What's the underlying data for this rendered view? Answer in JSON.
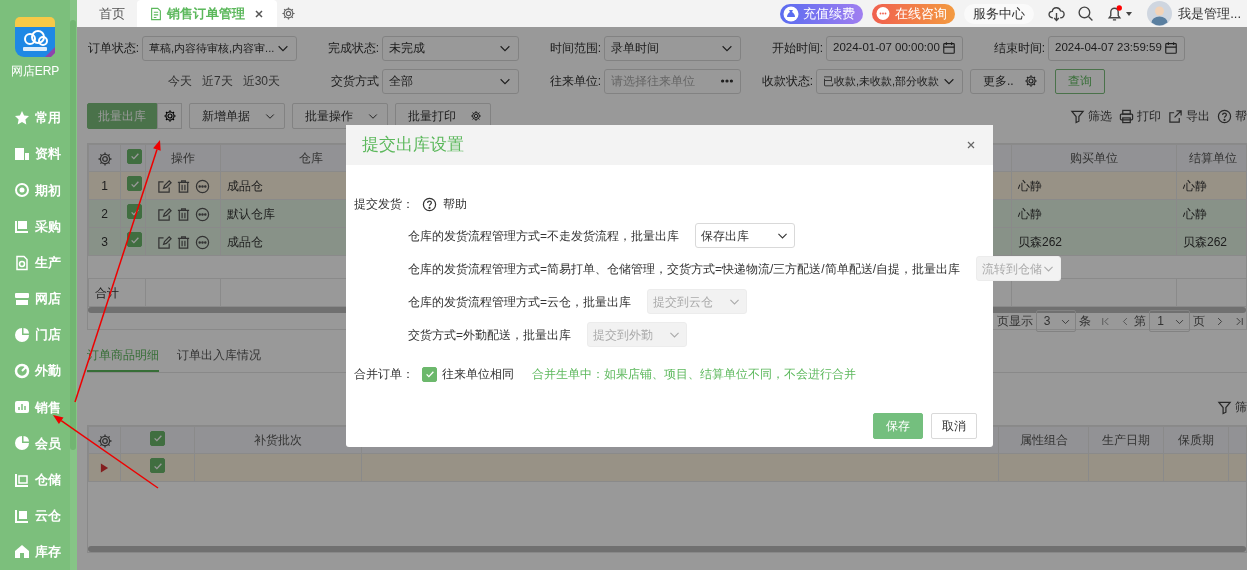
{
  "top_tabs": [
    {
      "label": "首页",
      "selected": false
    },
    {
      "label": "销售订单管理",
      "selected": true
    }
  ],
  "header": {
    "recharge": "充值续费",
    "consult": "在线咨询",
    "service": "服务中心",
    "user": "我是管理...",
    "unread": true
  },
  "sidebar": {
    "app_name": "网店ERP",
    "items": [
      {
        "label": "常用"
      },
      {
        "label": "资料"
      },
      {
        "label": "期初"
      },
      {
        "label": "采购"
      },
      {
        "label": "生产"
      },
      {
        "label": "网店"
      },
      {
        "label": "门店"
      },
      {
        "label": "外勤"
      },
      {
        "label": "销售"
      },
      {
        "label": "会员"
      },
      {
        "label": "仓储"
      },
      {
        "label": "云仓"
      },
      {
        "label": "库存"
      }
    ]
  },
  "filters": [
    [
      {
        "kind": "select",
        "label": "订单状态:",
        "value": "草稿,内容待审核,内容审..."
      },
      {
        "kind": "select",
        "label": "完成状态:",
        "value": "未完成"
      },
      {
        "kind": "select",
        "label": "时间范围:",
        "value": "录单时间"
      },
      {
        "kind": "date",
        "label": "开始时间:",
        "value": "2024-01-07 00:00:00"
      },
      {
        "kind": "date",
        "label": "结束时间:",
        "value": "2024-04-07 23:59:59"
      }
    ],
    [
      {
        "kind": "quick_dates",
        "options": [
          "今天",
          "近7天",
          "近30天"
        ]
      },
      {
        "kind": "select",
        "label": "交货方式",
        "value": "全部"
      },
      {
        "kind": "lookup",
        "label": "往来单位:",
        "placeholder": "请选择往来单位"
      },
      {
        "kind": "select",
        "label": "收款状态:",
        "value": "已收款,未收款,部分收款"
      },
      {
        "kind": "more",
        "label": "更多.."
      },
      {
        "kind": "search",
        "label": "查询"
      }
    ]
  ],
  "toolbar": {
    "buttons": [
      {
        "kind": "split-primary",
        "label": "批量出库"
      },
      {
        "kind": "dropdown",
        "label": "新增单据"
      },
      {
        "kind": "dropdown",
        "label": "批量操作"
      },
      {
        "kind": "split",
        "label": "批量打印"
      }
    ],
    "actions": [
      {
        "kind": "filter",
        "label": "筛选"
      },
      {
        "kind": "print",
        "label": "打印"
      },
      {
        "kind": "export",
        "label": "导出"
      },
      {
        "kind": "help",
        "label": "帮"
      }
    ]
  },
  "orders_table": {
    "header_checked": true,
    "columns": [
      "操作",
      "仓库",
      "购买单位",
      "结算单位"
    ],
    "rows": [
      {
        "number": "1",
        "checked": true,
        "current": true,
        "warehouse": "成品仓",
        "buyer": "心静",
        "settlement": "心静"
      },
      {
        "number": "2",
        "checked": true,
        "current": false,
        "warehouse": "默认仓库",
        "buyer": "心静",
        "settlement": "心静"
      },
      {
        "number": "3",
        "checked": true,
        "current": false,
        "warehouse": "成品仓",
        "buyer": "贝森262",
        "settlement": "贝森262"
      }
    ],
    "total_label": "合计"
  },
  "pagination": {
    "page_size_label": "页显示",
    "page_size": "3",
    "unit": "条",
    "page_label": "第",
    "page": "1",
    "page_unit": "页"
  },
  "detail_tabs": [
    {
      "label": "订单商品明细",
      "selected": true
    },
    {
      "label": "订单出入库情况",
      "selected": false
    }
  ],
  "detail_toolbar": {
    "filter_label": "筛"
  },
  "detail_table": {
    "header_checked": true,
    "columns": [
      "补货批次",
      "属性组合",
      "生产日期",
      "保质期"
    ],
    "rows": [
      {
        "checked": true,
        "current": true
      }
    ]
  },
  "dialog": {
    "open": true,
    "title": "提交出库设置",
    "section_label": "提交发货：",
    "help": "帮助",
    "rules": [
      {
        "condition": "仓库的发货流程管理方式=不走发货流程，批量出库",
        "value": "保存出库",
        "disabled": false
      },
      {
        "condition": "仓库的发货流程管理方式=简易打单、仓储管理，交货方式=快递物流/三方配送/简单配送/自提，批量出库",
        "value": "流转到仓储",
        "disabled": true
      },
      {
        "condition": "仓库的发货流程管理方式=云仓，批量出库",
        "value": "提交到云仓",
        "disabled": true
      },
      {
        "condition": "交货方式=外勤配送，批量出库",
        "value": "提交到外勤",
        "disabled": true
      }
    ],
    "merge_label": "合并订单：",
    "merge_option": {
      "label": "往来单位相同",
      "checked": true
    },
    "merge_note": "合并生单中：如果店铺、项目、结算单位不同，不会进行合并",
    "buttons": {
      "save": "保存",
      "cancel": "取消"
    }
  }
}
